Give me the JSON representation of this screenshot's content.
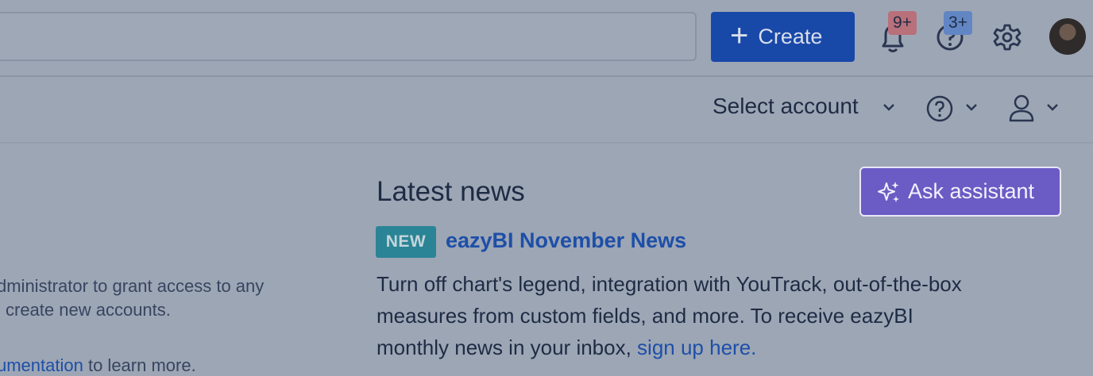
{
  "header": {
    "search_placeholder": "",
    "create_label": "Create",
    "notifications_badge": "9+",
    "help_badge": "3+"
  },
  "subbar": {
    "select_account_label": "Select account"
  },
  "left_panel": {
    "line1": "dministrator to grant access to any",
    "line2": "create new accounts.",
    "link_text": "umentation",
    "line3_rest": " to learn more."
  },
  "news": {
    "section_title": "Latest news",
    "ask_assistant_label": "Ask assistant",
    "new_badge": "NEW",
    "headline": "eazyBI November News",
    "body_line1": "Turn off chart's legend, integration with YouTrack, out-of-the-box",
    "body_line2": "measures from custom fields, and more. To receive eazyBI",
    "body_line3_prefix": "monthly news in your inbox, ",
    "signup_link": "sign up here."
  },
  "colors": {
    "overlay_bg": "#9da6b5",
    "primary_button": "#1848a8",
    "assistant_button": "#6b5bc4",
    "new_badge": "#2a8496",
    "link": "#1d4fa8"
  }
}
